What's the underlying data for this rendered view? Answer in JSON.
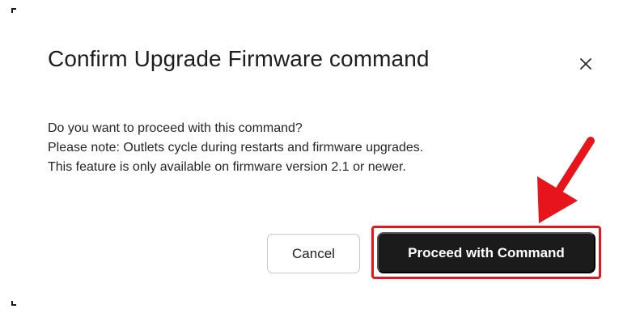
{
  "dialog": {
    "title": "Confirm Upgrade Firmware command",
    "close_icon": "close-icon",
    "body_lines": [
      "Do you want to proceed with this command?",
      "Please note: Outlets cycle during restarts and firmware upgrades.",
      "This feature is only available on firmware version 2.1 or newer."
    ],
    "buttons": {
      "cancel_label": "Cancel",
      "proceed_label": "Proceed with Command"
    }
  },
  "annotation": {
    "highlight_color": "#e8141c",
    "arrow_icon": "arrow-down-left-icon"
  },
  "colors": {
    "primary_button_bg": "#1b1b1b",
    "primary_button_text": "#ffffff",
    "secondary_button_border": "#c8c8c8"
  }
}
